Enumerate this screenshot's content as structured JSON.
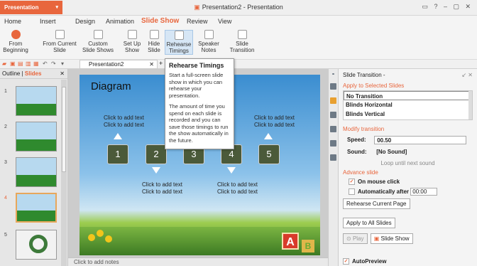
{
  "app": {
    "button_label": "Presentation",
    "doc_title": "Presentation2 - Presentation"
  },
  "menu": [
    "Home",
    "Insert",
    "Design",
    "Animation",
    "Slide Show",
    "Review",
    "View"
  ],
  "ribbon": [
    {
      "line1": "From",
      "line2": "Beginning"
    },
    {
      "line1": "From Current",
      "line2": "Slide"
    },
    {
      "line1": "Custom",
      "line2": "Slide Shows"
    },
    {
      "line1": "Set Up",
      "line2": "Show"
    },
    {
      "line1": "Hide",
      "line2": "Slide"
    },
    {
      "line1": "Rehearse",
      "line2": "Timings"
    },
    {
      "line1": "Speaker",
      "line2": "Notes"
    },
    {
      "line1": "Slide",
      "line2": "Transition"
    }
  ],
  "doc_tab": "Presentation2",
  "tooltip": {
    "title": "Rehearse Timings",
    "p1": "Start a full-screen slide show in which you can rehearse your presentation.",
    "p2": "The amount of time you spend on each slide is recorded and you can save those timings to run the show automatically in the future."
  },
  "left_panel": {
    "tab_outline": "Outline",
    "tab_slides": "Slides",
    "numbers": [
      "1",
      "2",
      "3",
      "4",
      "5"
    ]
  },
  "slide": {
    "title": "Diagram",
    "steps": [
      "1",
      "2",
      "3",
      "4",
      "5"
    ],
    "placeholder": "Click to add text"
  },
  "notes_placeholder": "Click to add notes",
  "pane": {
    "title": "Slide Transition -",
    "apply_selected": "Apply to Selected Slides",
    "transitions": [
      "No Transition",
      "Blinds Horizontal",
      "Blinds Vertical"
    ],
    "modify": "Modify transition",
    "speed_label": "Speed:",
    "speed_value": "00.50",
    "sound_label": "Sound:",
    "sound_value": "[No Sound]",
    "loop": "Loop until next sound",
    "advance": "Advance slide",
    "on_click": "On mouse click",
    "auto_after": "Automatically after",
    "auto_time": "00:00",
    "rehearse_current": "Rehearse Current Page",
    "apply_all": "Apply to All Slides",
    "play": "Play",
    "slide_show": "Slide Show",
    "autopreview": "AutoPreview"
  }
}
